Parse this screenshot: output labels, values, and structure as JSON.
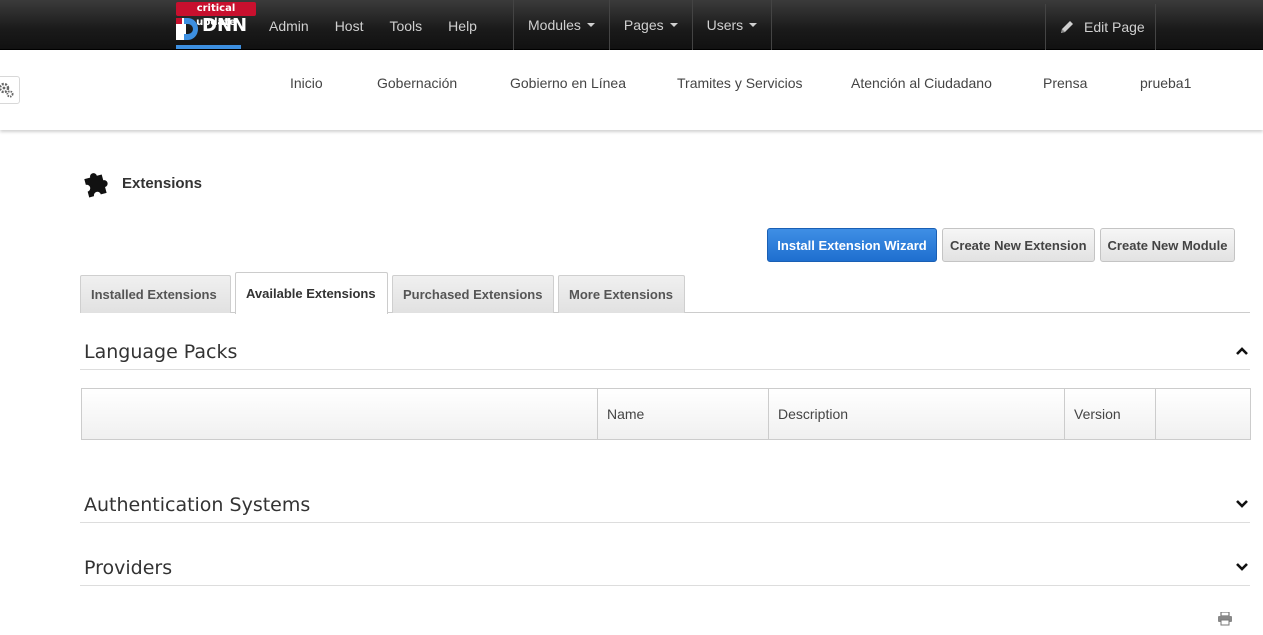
{
  "controlbar": {
    "badge": "critical update",
    "logo_text": "DNN",
    "left_menu": [
      "Admin",
      "Host",
      "Tools",
      "Help"
    ],
    "mid_menu": [
      "Modules",
      "Pages",
      "Users"
    ],
    "edit_page": "Edit Page"
  },
  "sitenav": {
    "links": [
      "Inicio",
      "Gobernación",
      "Gobierno en Línea",
      "Tramites y Servicios",
      "Atención al Ciudadano",
      "Prensa",
      "prueba1"
    ]
  },
  "module": {
    "title": "Extensions",
    "buttons": {
      "install": "Install Extension Wizard",
      "create_extension": "Create New Extension",
      "create_module": "Create New Module"
    },
    "tabs": [
      "Installed Extensions",
      "Available Extensions",
      "Purchased Extensions",
      "More Extensions"
    ],
    "active_tab": "Available Extensions"
  },
  "sections": {
    "language_packs": "Language Packs",
    "authentication": "Authentication Systems",
    "providers": "Providers"
  },
  "grid": {
    "columns": [
      "",
      "Name",
      "Description",
      "Version",
      ""
    ]
  },
  "icons": {
    "gear": "gear-icon",
    "pencil": "pencil-icon",
    "puzzle": "puzzle-icon",
    "chevron_up": "chevron-up-icon",
    "chevron_down": "chevron-down-icon",
    "print": "print-icon"
  },
  "colors": {
    "accent": "#2a7ad8",
    "badge": "#c8102e",
    "controlbar": "#1a1a1a"
  }
}
